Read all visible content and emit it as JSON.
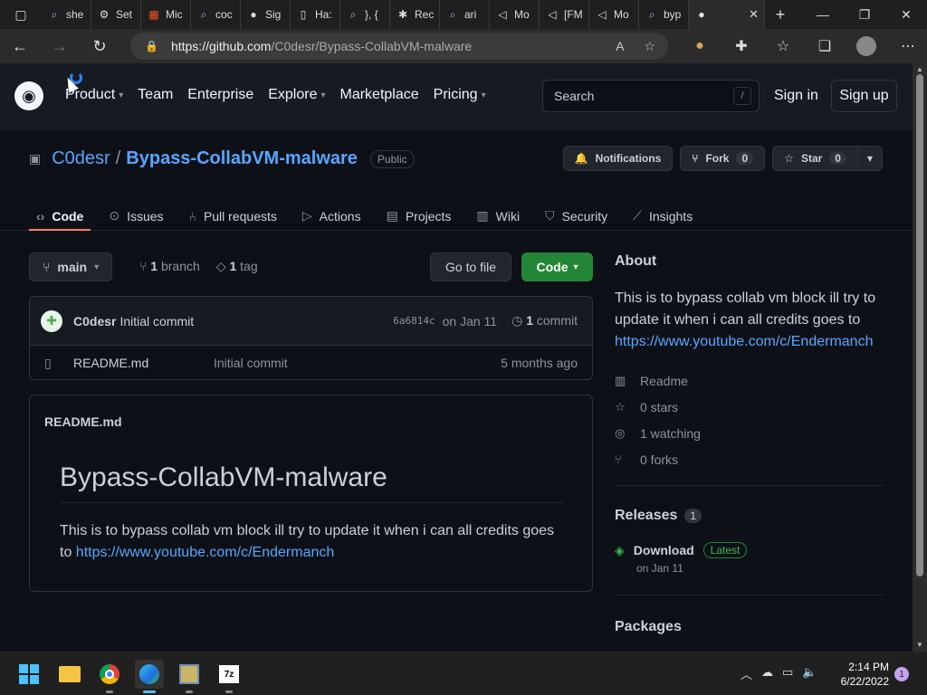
{
  "browser": {
    "tabs": [
      {
        "label": "she",
        "icon": "search-icon"
      },
      {
        "label": "Set",
        "icon": "gear-icon"
      },
      {
        "label": "Mic",
        "icon": "microsoft-icon"
      },
      {
        "label": "coc",
        "icon": "search-icon"
      },
      {
        "label": "Sig",
        "icon": "github-icon"
      },
      {
        "label": "Ha:",
        "icon": "document-icon"
      },
      {
        "label": "}, {",
        "icon": "search-icon"
      },
      {
        "label": "Rec",
        "icon": "bug-icon"
      },
      {
        "label": "ari",
        "icon": "search-icon"
      },
      {
        "label": "Mo",
        "icon": "speaker-icon"
      },
      {
        "label": "[FM",
        "icon": "speaker-icon"
      },
      {
        "label": "Mo",
        "icon": "speaker-icon"
      },
      {
        "label": "byp",
        "icon": "search-icon"
      }
    ],
    "active_tab": {
      "label": "",
      "icon": "github-icon"
    },
    "url_host": "https://github.com",
    "url_path": "/C0desr/Bypass-CollabVM-malware"
  },
  "gh_header": {
    "nav": [
      {
        "label": "Product",
        "caret": true
      },
      {
        "label": "Team",
        "caret": false
      },
      {
        "label": "Enterprise",
        "caret": false
      },
      {
        "label": "Explore",
        "caret": true
      },
      {
        "label": "Marketplace",
        "caret": false
      },
      {
        "label": "Pricing",
        "caret": true
      }
    ],
    "search_placeholder": "Search",
    "search_key": "/",
    "signin": "Sign in",
    "signup": "Sign up"
  },
  "repo": {
    "owner": "C0desr",
    "separator": "/",
    "name": "Bypass-CollabVM-malware",
    "visibility": "Public",
    "notifications": "Notifications",
    "fork_label": "Fork",
    "fork_count": "0",
    "star_label": "Star",
    "star_count": "0",
    "tabs": [
      {
        "label": "Code",
        "icon": "code-icon"
      },
      {
        "label": "Issues",
        "icon": "issue-icon"
      },
      {
        "label": "Pull requests",
        "icon": "pull-request-icon"
      },
      {
        "label": "Actions",
        "icon": "play-icon"
      },
      {
        "label": "Projects",
        "icon": "table-icon"
      },
      {
        "label": "Wiki",
        "icon": "book-icon"
      },
      {
        "label": "Security",
        "icon": "shield-icon"
      },
      {
        "label": "Insights",
        "icon": "graph-icon"
      }
    ]
  },
  "branch_bar": {
    "branch": "main",
    "branch_count": "1",
    "branch_word": "branch",
    "tag_count": "1",
    "tag_word": "tag",
    "go_to_file": "Go to file",
    "code": "Code"
  },
  "commit": {
    "author": "C0desr",
    "message": "Initial commit",
    "hash": "6a6814c",
    "date": "on Jan 11",
    "count": "1",
    "count_word": "commit"
  },
  "files": [
    {
      "name": "README.md",
      "commit": "Initial commit",
      "age": "5 months ago"
    }
  ],
  "readme": {
    "label": "README.md",
    "heading": "Bypass-CollabVM-malware",
    "text": "This is to bypass collab vm block ill try to update it when i can all credits goes to ",
    "link": "https://www.youtube.com/c/Endermanch"
  },
  "about": {
    "title": "About",
    "text": "This is to bypass collab vm block ill try to update it when i can all credits goes to ",
    "link": "https://www.youtube.com/c/Endermanch",
    "items": [
      {
        "label": "Readme",
        "icon": "book-icon"
      },
      {
        "label": "0 stars",
        "icon": "star-icon"
      },
      {
        "label": "1 watching",
        "icon": "eye-icon"
      },
      {
        "label": "0 forks",
        "icon": "fork-icon"
      }
    ]
  },
  "releases": {
    "title": "Releases",
    "count": "1",
    "name": "Download",
    "badge": "Latest",
    "date": "on Jan 11"
  },
  "packages": {
    "title": "Packages"
  },
  "taskbar": {
    "time": "2:14 PM",
    "date": "6/22/2022",
    "notifications": "1"
  }
}
